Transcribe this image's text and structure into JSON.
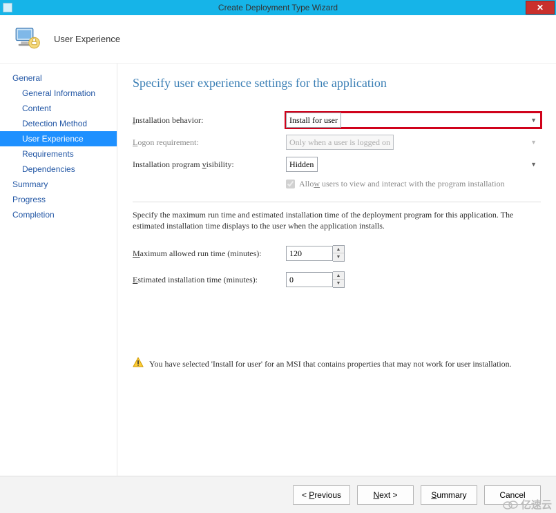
{
  "window": {
    "title": "Create Deployment Type Wizard",
    "close_glyph": "✕"
  },
  "header": {
    "title": "User Experience"
  },
  "sidebar": {
    "items": [
      {
        "label": "General",
        "indent": 0
      },
      {
        "label": "General Information",
        "indent": 1
      },
      {
        "label": "Content",
        "indent": 1
      },
      {
        "label": "Detection Method",
        "indent": 1
      },
      {
        "label": "User Experience",
        "indent": 1,
        "active": true
      },
      {
        "label": "Requirements",
        "indent": 1
      },
      {
        "label": "Dependencies",
        "indent": 1
      },
      {
        "label": "Summary",
        "indent": 0
      },
      {
        "label": "Progress",
        "indent": 0
      },
      {
        "label": "Completion",
        "indent": 0
      }
    ]
  },
  "main": {
    "title": "Specify user experience settings for the application",
    "fields": {
      "install_behavior_label": "Installation behavior:",
      "install_behavior_value": "Install for user",
      "logon_req_label": "Logon requirement:",
      "logon_req_value": "Only when a user is logged on",
      "visibility_label": "Installation program visibility:",
      "visibility_value": "Hidden",
      "allow_interact_label": "Allow users to view and interact with the program installation"
    },
    "desc": "Specify the maximum run time and estimated installation time of the deployment program for this application. The estimated installation time displays to the user when the application installs.",
    "max_runtime_label": "Maximum allowed run time (minutes):",
    "max_runtime_value": "120",
    "est_time_label": "Estimated installation time (minutes):",
    "est_time_value": "0",
    "warning": "You have selected 'Install for user' for an MSI that contains properties that may not work for user installation."
  },
  "buttons": {
    "previous": "< Previous",
    "next": "Next >",
    "summary": "Summary",
    "cancel": "Cancel"
  },
  "watermark": "亿速云"
}
